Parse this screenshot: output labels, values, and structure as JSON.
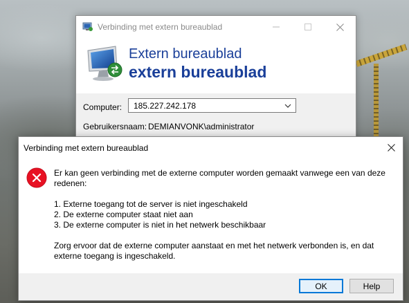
{
  "background_window": {
    "title": "Verbinding met extern bureaublad",
    "banner_line1": "Extern bureaublad",
    "banner_line2": "extern bureaublad",
    "computer_label": "Computer:",
    "computer_value": "185.227.242.178",
    "username_label": "Gebruikersnaam:",
    "username_value": "DEMIANVONK\\administrator"
  },
  "dialog": {
    "title": "Verbinding met extern bureaublad",
    "message_intro": "Er kan geen verbinding met de externe computer worden gemaakt vanwege een van deze redenen:",
    "reasons": [
      "1. Externe toegang tot de server is niet ingeschakeld",
      "2. De externe computer staat niet aan",
      "3. De externe computer is niet in het netwerk beschikbaar"
    ],
    "message_outro": "Zorg ervoor dat de externe computer aanstaat en met het netwerk verbonden is, en dat externe toegang is ingeschakeld.",
    "ok_label": "OK",
    "help_label": "Help"
  },
  "colors": {
    "accent": "#0078d7",
    "banner_text": "#1a3f99",
    "error_red": "#e81123"
  },
  "icons": {
    "title_icon": "remote-desktop-icon",
    "banner_icon": "remote-desktop-icon",
    "error_icon": "error-icon"
  }
}
